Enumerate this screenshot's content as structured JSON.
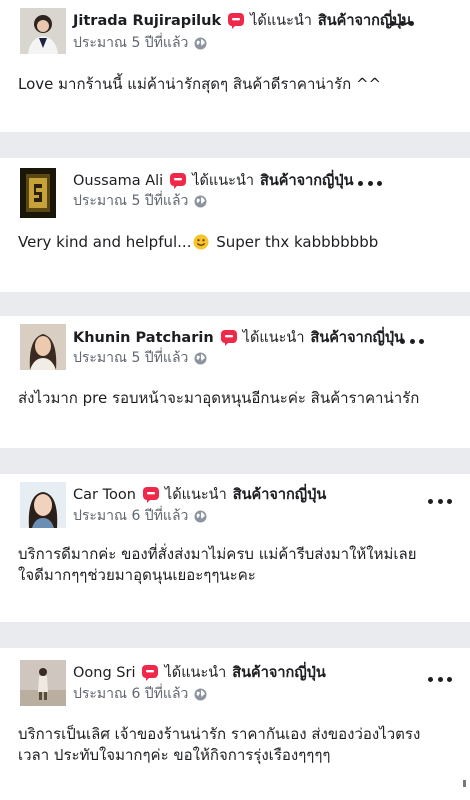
{
  "recommend_icon": "recommendation-speech-bubble-icon",
  "privacy_icon": "globe-icon",
  "more_icon": "more-options-icon",
  "colors": {
    "recommend": "#f02849",
    "meta_text": "#606770",
    "separator": "#e9ebee"
  },
  "reviews": [
    {
      "author": "Jitrada Rujirapiluk",
      "recommend_text": "ได้แนะนำ",
      "page_name": "สินค้าจากญี่ปุ่น",
      "time": "ประมาณ 5 ปีที่แล้ว",
      "text_lines": [
        "Love มากร้านนี้ แม่ค้าน่ารักสุดๆ สินค้าดีราคาน่ารัก ^^"
      ]
    },
    {
      "author": "Oussama Ali",
      "recommend_text": "ได้แนะนำ",
      "page_name": "สินค้าจากญี่ปุ่น",
      "time": "ประมาณ 5 ปีที่แล้ว",
      "text_before_emoji": "Very kind and helpful...",
      "emoji": "smiling-face-emoji",
      "text_after_emoji": " Super thx kabbbbbbb"
    },
    {
      "author": "Khunin Patcharin",
      "recommend_text": "ได้แนะนำ",
      "page_name": "สินค้าจากญี่ปุ่น",
      "time": "ประมาณ 5 ปีที่แล้ว",
      "text_lines": [
        "ส่งไวมาก pre รอบหน้าจะมาอุดหนุนอีกนะค่ะ สินค้าราคาน่ารัก"
      ]
    },
    {
      "author": "Car Toon",
      "recommend_text": "ได้แนะนำ",
      "page_name": "สินค้าจากญี่ปุ่น",
      "time": "ประมาณ 6 ปีที่แล้ว",
      "text_lines": [
        "บริการดีมากค่ะ ของที่สั่งส่งมาไม่ครบ แม่ค้ารีบส่งมาให้ใหม่เลย",
        "ใจดีมากๆๆช่วยมาอุดนุนเยอะๆๆนะคะ"
      ]
    },
    {
      "author": "Oong Sri",
      "recommend_text": "ได้แนะนำ",
      "page_name": "สินค้าจากญี่ปุ่น",
      "time": "ประมาณ 6 ปีที่แล้ว",
      "text_lines": [
        "บริการเป็นเลิศ เจ้าของร้านน่ารัก ราคากันเอง ส่งของว่องไวตรง",
        "เวลา ประทับใจมากๆค่ะ ขอให้กิจการรุ่งเรืองๆๆๆๆ"
      ]
    }
  ]
}
